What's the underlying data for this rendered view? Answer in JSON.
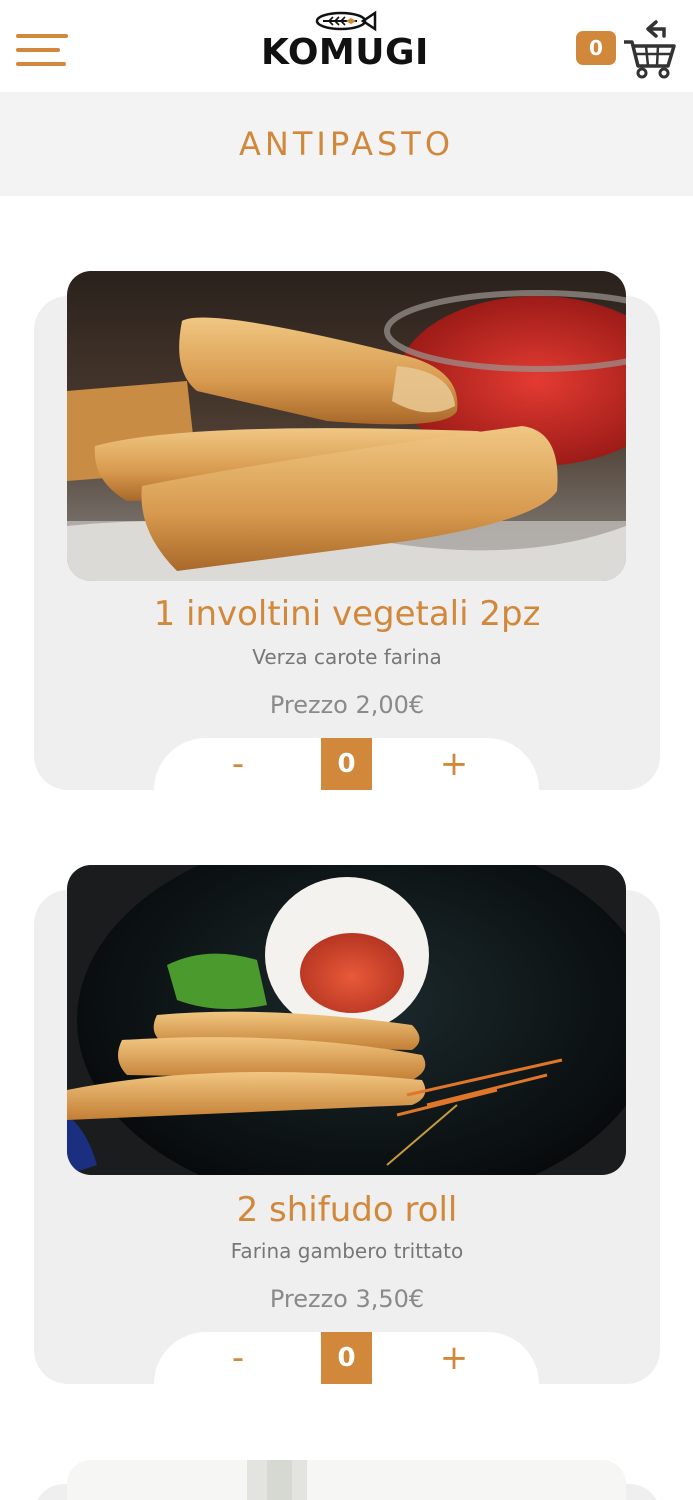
{
  "header": {
    "logo_text": "KOMUGI",
    "cart_count": "0",
    "menu_icon": "hamburger-menu-icon",
    "cart_icon": "shopping-cart-icon"
  },
  "section": {
    "title": "ANTIPASTO"
  },
  "products": [
    {
      "title": "1 involtini vegetali 2pz",
      "description": "Verza carote farina",
      "price": "Prezzo 2,00€",
      "minus": "-",
      "quantity": "0",
      "plus": "+"
    },
    {
      "title": "2 shifudo roll",
      "description": "Farina gambero trittato",
      "price": "Prezzo 3,50€",
      "minus": "-",
      "quantity": "0",
      "plus": "+"
    }
  ],
  "colors": {
    "accent": "#d2883a",
    "card_bg": "#efefef",
    "section_bg": "#f3f3f3"
  }
}
